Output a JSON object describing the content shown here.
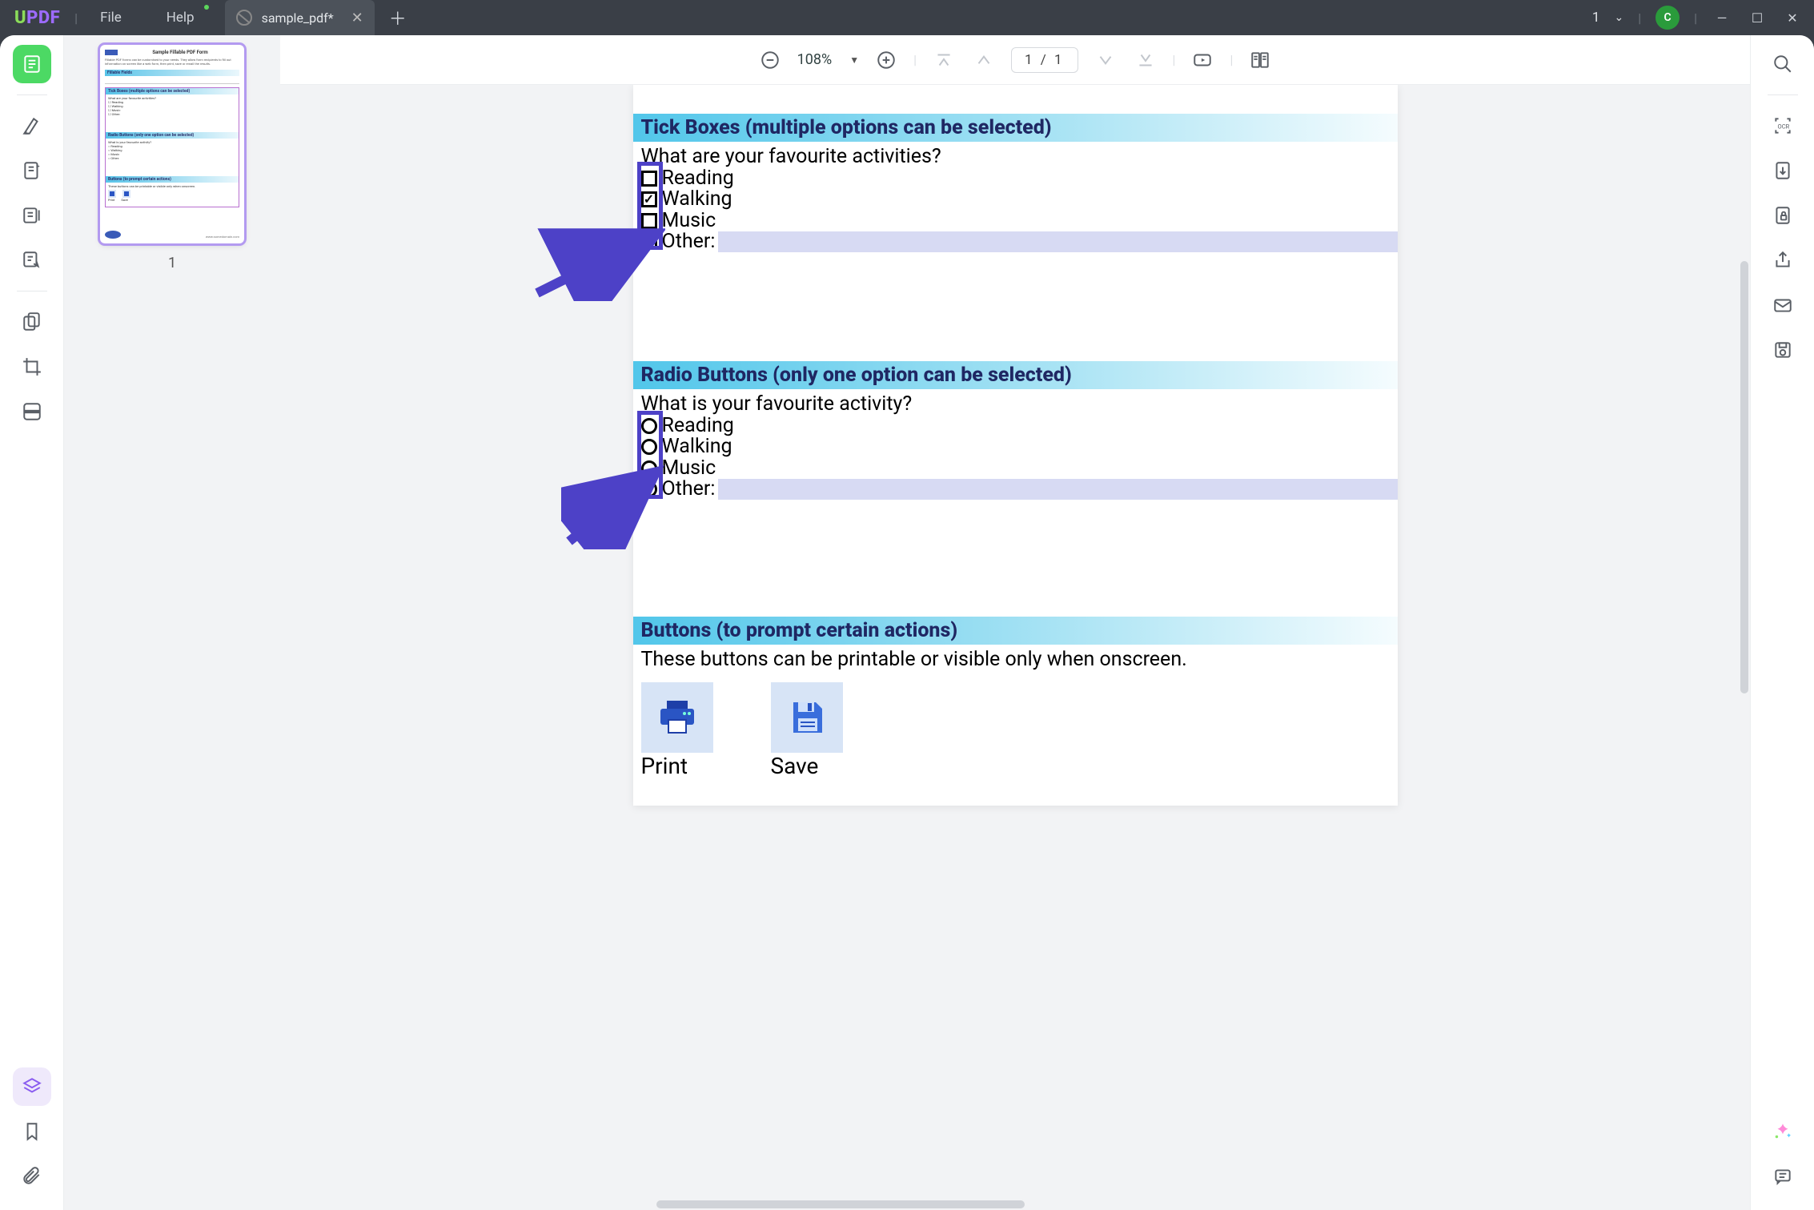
{
  "app": {
    "logo_u": "U",
    "logo_pdf": "PDF"
  },
  "menu": {
    "file": "File",
    "help": "Help"
  },
  "tab": {
    "title": "sample_pdf*"
  },
  "titlebar": {
    "count": "1",
    "avatar": "C"
  },
  "toolbar": {
    "zoom": "108%",
    "page": "1  /  1"
  },
  "thumbnail": {
    "page_number": "1",
    "title": "Sample Fillable PDF Form",
    "blurb": "Fillable PDF forms can be customised to your needs. They allow form recipients to fill out information on screen like a web form, then print, save or email the results.",
    "fillable_bar": "Fillable Fields",
    "tick_bar": "Tick Boxes (multiple options can be selected)",
    "tick_q": "What are your favourite activities?",
    "radio_bar": "Radio Buttons (only one option can be selected)",
    "radio_q": "What is your favourite activity?",
    "btn_bar": "Buttons (to prompt certain actions)",
    "btn_note": "These buttons can be printable or visible only when onscreen.",
    "opts": {
      "reading": "Reading",
      "walking": "Walking",
      "music": "Music",
      "other": "Other:"
    },
    "print": "Print",
    "save": "Save",
    "url": "www.somedomain.com"
  },
  "doc": {
    "tick_heading": "Tick Boxes (multiple options can be selected)",
    "tick_question": "What are your favourite activities?",
    "tick_options": {
      "reading": "Reading",
      "walking": "Walking",
      "music": "Music",
      "other": "Other:"
    },
    "radio_heading": "Radio Buttons (only one option can be selected)",
    "radio_question": "What is your favourite activity?",
    "radio_options": {
      "reading": "Reading",
      "walking": "Walking",
      "music": "Music",
      "other": "Other:"
    },
    "button_heading": "Buttons (to prompt certain actions)",
    "button_note": "These buttons can be printable or visible only when onscreen.",
    "print": "Print",
    "save": "Save"
  }
}
